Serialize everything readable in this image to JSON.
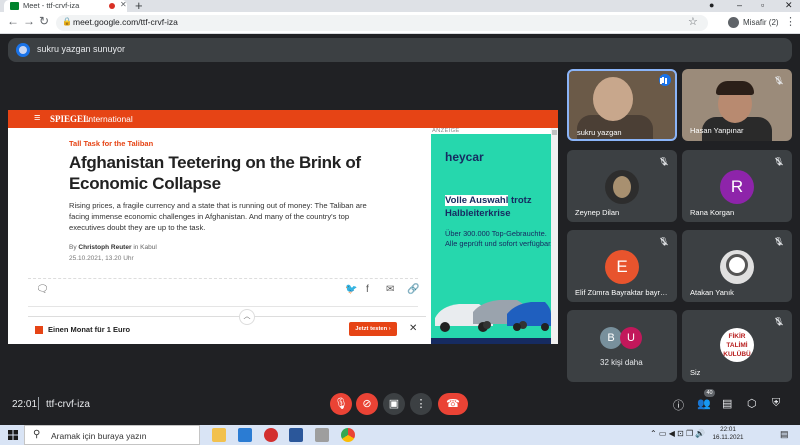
{
  "browser": {
    "tab_title": "Meet - ttf-crvf-iza",
    "url": "meet.google.com/ttf-crvf-iza",
    "profile_name": "Misafir (2)"
  },
  "meet": {
    "presenting_text": "sukru yazgan sunuyor",
    "time": "22:01",
    "meeting_code": "ttf-crvf-iza",
    "participants_badge": "40",
    "tiles": {
      "sukru": "sukru yazgan",
      "hasan": "Hasan Yanpınar",
      "zeynep": "Zeynep Dilan",
      "rana": "Rana Korgan",
      "rana_initial": "R",
      "elif": "Elif Zümra Bayraktar bayr…",
      "elif_initial": "E",
      "atakan": "Atakan Yanık",
      "more_count": "32 kişi daha",
      "more_b": "B",
      "more_u": "U",
      "self": "Siz",
      "self_logo_line1": "FİKİR",
      "self_logo_line2": "TALİMİ",
      "self_logo_line3": "KULÜBÜ"
    }
  },
  "article": {
    "logo": "SPIEGEL",
    "section": "International",
    "kicker": "Tall Task for the Taliban",
    "headline": "Afghanistan Teetering on the Brink of Economic Collapse",
    "teaser": "Rising prices, a fragile currency and a state that is running out of money: The Taliban are facing immense economic challenges in Afghanistan. And many of the country's top executives doubt they are up to the task.",
    "byline_prefix": "By",
    "author": "Christoph Reuter",
    "byline_suffix": "in Kabul",
    "date": "25.10.2021, 13.20 Uhr",
    "promo_text": "Einen Monat für 1 Euro",
    "promo_button": "Jetzt testen  ›",
    "ad_label": "ANZEIGE",
    "ad_logo": "heycar",
    "ad_head_1": "Volle Auswahl",
    "ad_head_2": "trotz Halbleiterkrise",
    "ad_body": "Über 300.000 Top-Gebrauchte. Alle geprüft und sofort verfügbar."
  },
  "taskbar": {
    "search_placeholder": "Aramak için buraya yazın",
    "clock_time": "22:01",
    "clock_date": "16.11.2021"
  },
  "colors": {
    "spiegel_red": "#e64415",
    "meet_bg": "#202124",
    "tile_bg": "#3c4043",
    "end_call": "#ea4335",
    "ad_green": "#26d7ad"
  }
}
